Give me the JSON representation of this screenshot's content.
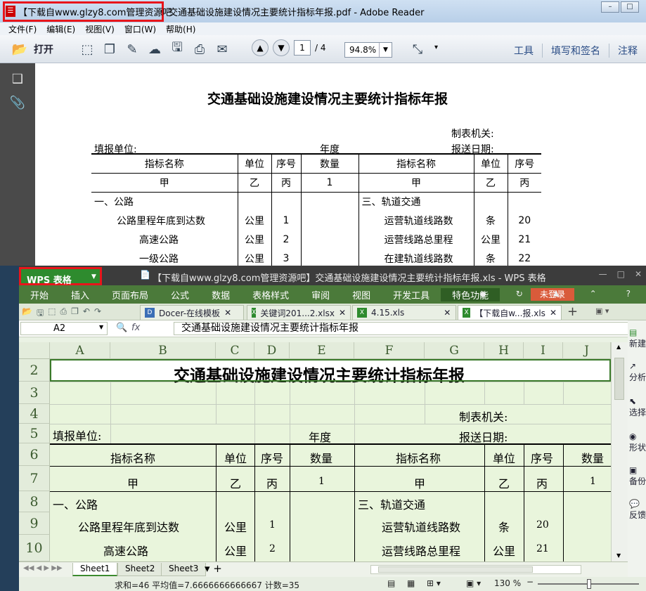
{
  "adobe": {
    "title_prefix": "【下载自www.glzy8.com管理资源吧",
    "title": "交通基础设施建设情况主要统计指标年报.pdf - Adobe Reader",
    "menu": [
      "文件(F)",
      "编辑(E)",
      "视图(V)",
      "窗口(W)",
      "帮助(H)"
    ],
    "open_label": "打开",
    "page_current": "1",
    "page_total": "/ 4",
    "zoom": "94.8%",
    "links": [
      "工具",
      "填写和签名",
      "注释"
    ]
  },
  "pdf": {
    "title": "交通基础设施建设情况主要统计指标年报",
    "authority": "制表机关:",
    "filler": "填报单位:",
    "year": "年度",
    "report_date": "报送日期:",
    "headers": [
      "指标名称",
      "单位",
      "序号",
      "数量",
      "指标名称",
      "单位",
      "序号"
    ],
    "sub": [
      "甲",
      "乙",
      "丙",
      "1",
      "甲",
      "乙",
      "丙"
    ],
    "rows": [
      [
        "一、公路",
        "",
        "",
        "",
        "三、轨道交通",
        "",
        ""
      ],
      [
        "公路里程年底到达数",
        "公里",
        "1",
        "",
        "运营轨道线路数",
        "条",
        "20"
      ],
      [
        "高速公路",
        "公里",
        "2",
        "",
        "运营线路总里程",
        "公里",
        "21"
      ],
      [
        "一级公路",
        "公里",
        "3",
        "",
        "在建轨道线路数",
        "条",
        "22"
      ]
    ]
  },
  "wps": {
    "brand": "WPS 表格",
    "title": "【下载自www.glzy8.com管理资源吧】交通基础设施建设情况主要统计指标年报.xls - WPS 表格",
    "tabs": [
      "开始",
      "插入",
      "页面布局",
      "公式",
      "数据",
      "表格样式",
      "审阅",
      "视图",
      "开发工具",
      "特色功能"
    ],
    "login": "未登录",
    "doctabs": [
      "Docer-在线模板",
      "关键词201...2.xlsx",
      "4.15.xls",
      "【下载自w...报.xls"
    ],
    "namebox": "A2",
    "fx": "fx",
    "formula": "交通基础设施建设情况主要统计指标年报",
    "columns": [
      "A",
      "B",
      "C",
      "D",
      "E",
      "F",
      "G",
      "H",
      "I",
      "J"
    ],
    "rownums": [
      "2",
      "3",
      "4",
      "5",
      "6",
      "7",
      "8",
      "9",
      "10"
    ],
    "sheet_title": "交通基础设施建设情况主要统计指标年报",
    "authority": "制表机关:",
    "filler": "填报单位:",
    "year": "年度",
    "report_date": "报送日期:",
    "h6": [
      "指标名称",
      "单位",
      "序号",
      "数量",
      "指标名称",
      "单位",
      "序号",
      "数量"
    ],
    "h7": [
      "甲",
      "乙",
      "丙",
      "1",
      "甲",
      "乙",
      "丙",
      "1"
    ],
    "r8": [
      "一、公路",
      "三、轨道交通"
    ],
    "r9": [
      "公路里程年底到达数",
      "公里",
      "1",
      "运营轨道线路数",
      "条",
      "20"
    ],
    "r10": [
      "高速公路",
      "公里",
      "2",
      "运营线路总里程",
      "公里",
      "21"
    ],
    "sheets": [
      "Sheet1",
      "Sheet2",
      "Sheet3"
    ],
    "side": [
      "新建",
      "分析",
      "选择",
      "形状",
      "备份",
      "反馈"
    ],
    "status": "求和=46  平均值=7.6666666666667  计数=35",
    "zoom": "130 %"
  }
}
